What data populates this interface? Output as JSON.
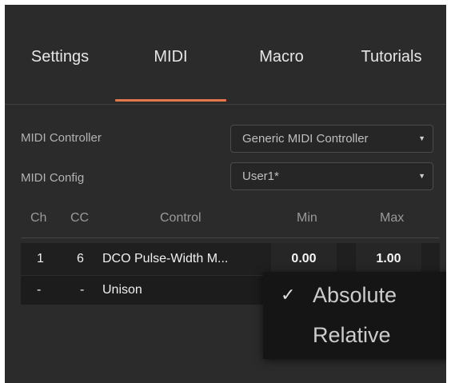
{
  "tabs": [
    {
      "label": "Settings"
    },
    {
      "label": "MIDI"
    },
    {
      "label": "Macro"
    },
    {
      "label": "Tutorials"
    }
  ],
  "active_tab": "MIDI",
  "accent_color": "#e4784a",
  "midi_controller": {
    "label": "MIDI Controller",
    "value": "Generic MIDI Controller"
  },
  "midi_config": {
    "label": "MIDI Config",
    "value": "User1*"
  },
  "table": {
    "headers": {
      "ch": "Ch",
      "cc": "CC",
      "control": "Control",
      "min": "Min",
      "max": "Max"
    },
    "rows": [
      {
        "ch": "1",
        "cc": "6",
        "control": "DCO Pulse-Width M...",
        "min": "0.00",
        "max": "1.00"
      },
      {
        "ch": "-",
        "cc": "-",
        "control": "Unison"
      }
    ]
  },
  "context_menu": {
    "items": [
      {
        "label": "Absolute",
        "checked": true,
        "check_glyph": "✓"
      },
      {
        "label": "Relative",
        "checked": false
      }
    ]
  }
}
